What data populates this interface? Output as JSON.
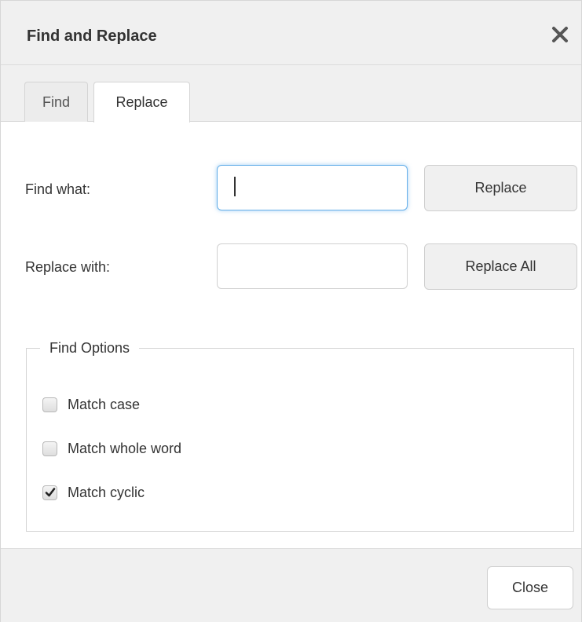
{
  "dialog": {
    "title": "Find and Replace",
    "close_icon": "close-x-icon"
  },
  "tabs": [
    {
      "label": "Find",
      "active": false
    },
    {
      "label": "Replace",
      "active": true
    }
  ],
  "form": {
    "find_label": "Find what:",
    "find_value": "",
    "replace_label": "Replace with:",
    "replace_value": "",
    "replace_button": "Replace",
    "replace_all_button": "Replace All"
  },
  "options": {
    "legend": "Find Options",
    "items": [
      {
        "label": "Match case",
        "checked": false
      },
      {
        "label": "Match whole word",
        "checked": false
      },
      {
        "label": "Match cyclic",
        "checked": true
      }
    ]
  },
  "footer": {
    "close_button": "Close"
  },
  "colors": {
    "focus_ring": "#66afe9",
    "chrome_bg": "#f0f0f0"
  }
}
